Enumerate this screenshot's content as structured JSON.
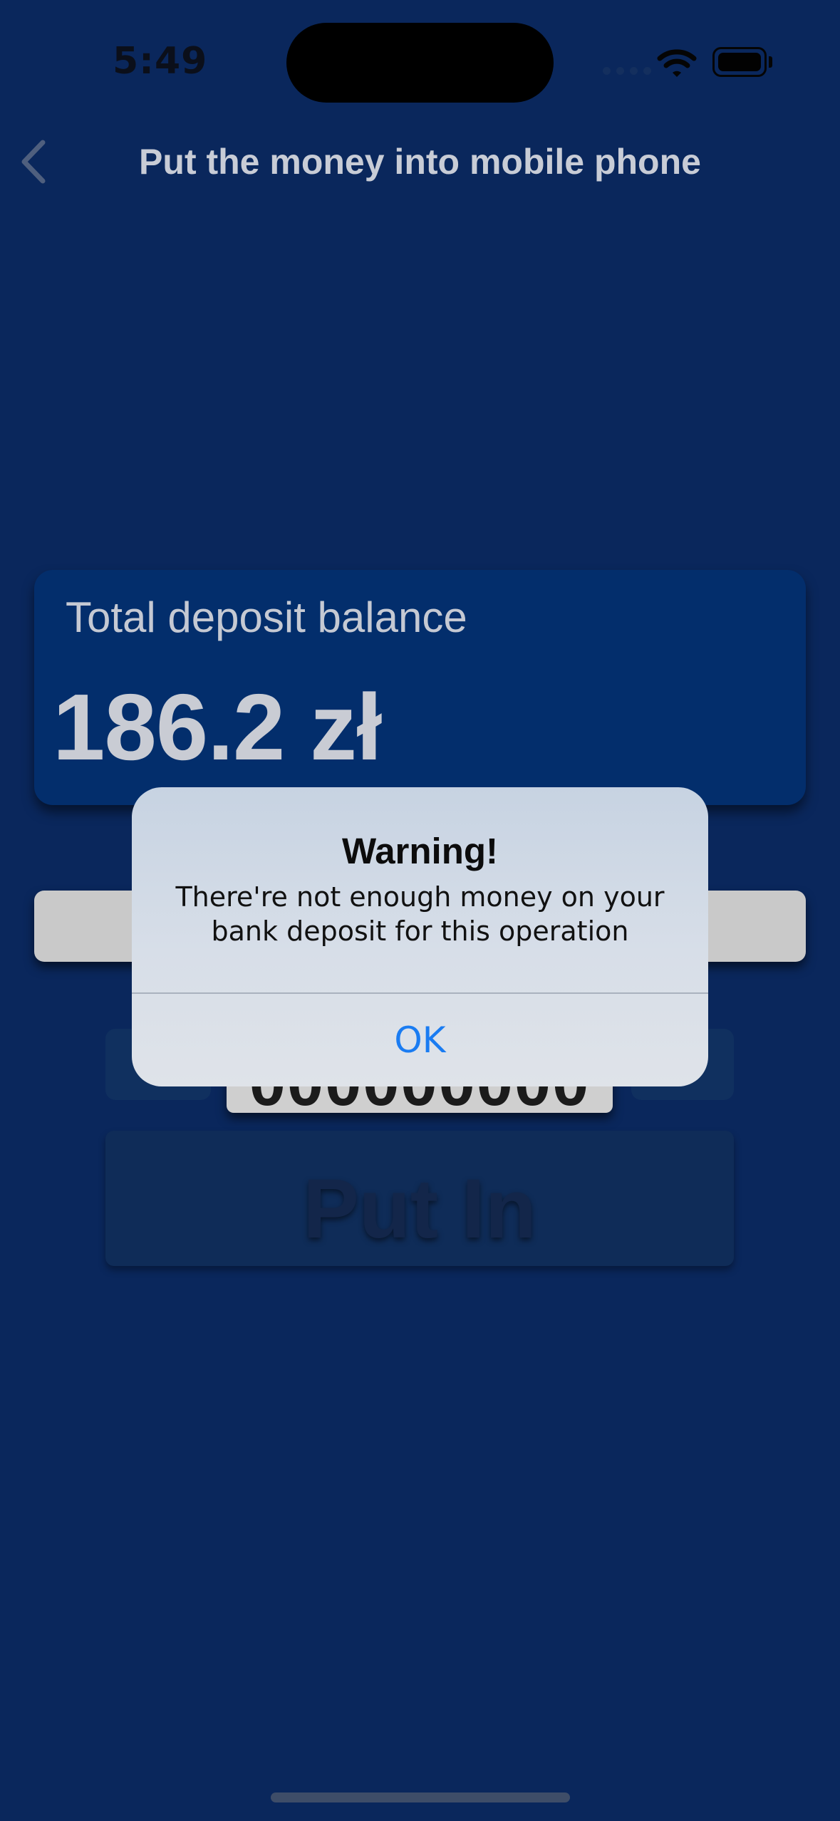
{
  "status_bar": {
    "time": "5:49"
  },
  "nav": {
    "title": "Put the money into mobile phone"
  },
  "balance": {
    "label": "Total deposit balance",
    "value": "186.2 zł"
  },
  "form": {
    "phone_value": "000000000",
    "put_in_label": "Put In"
  },
  "alert": {
    "title": "Warning!",
    "message": "There're not enough money on your bank deposit for this operation",
    "ok_label": "OK"
  },
  "colors": {
    "background": "#0a275c",
    "card": "#032e6c",
    "alert_button": "#1a7cf2"
  }
}
